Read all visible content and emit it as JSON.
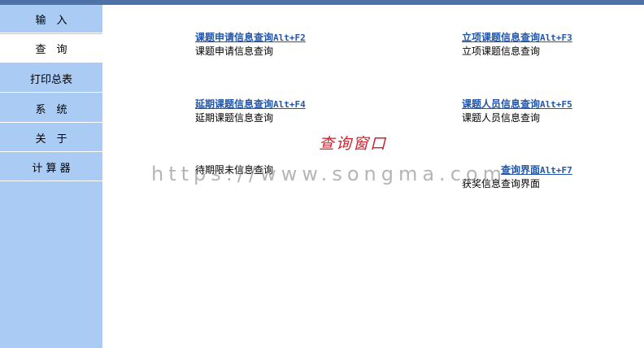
{
  "sidebar": {
    "items": [
      {
        "label": "输　入",
        "active": false
      },
      {
        "label": "查　询",
        "active": true
      },
      {
        "label": "打印总表",
        "active": false
      },
      {
        "label": "系　统",
        "active": false
      },
      {
        "label": "关　于",
        "active": false
      },
      {
        "label": "计 算 器",
        "active": false
      }
    ]
  },
  "main": {
    "queries": [
      {
        "link": "课题申请信息查询",
        "hotkey": "Alt+F2",
        "desc": "课题申请信息查询"
      },
      {
        "link": "立项课题信息查询",
        "hotkey": "Alt+F3",
        "desc": "立项课题信息查询"
      },
      {
        "link": "延期课题信息查询",
        "hotkey": "Alt+F4",
        "desc": "延期课题信息查询"
      },
      {
        "link": "课题人员信息查询",
        "hotkey": "Alt+F5",
        "desc": "课题人员信息查询"
      },
      {
        "link": "",
        "hotkey": "",
        "desc": "待期限未信息查询"
      },
      {
        "link": "查询界面",
        "hotkey": "Alt+F7",
        "desc": "获奖信息查询界面"
      }
    ],
    "window_title": "查询窗口",
    "watermark": "https://www.songma.com"
  },
  "colors": {
    "sidebar_bg": "#aacbf4",
    "topbar": "#4e72a8",
    "link": "#2356a8",
    "title_red": "#cf1f2a"
  }
}
